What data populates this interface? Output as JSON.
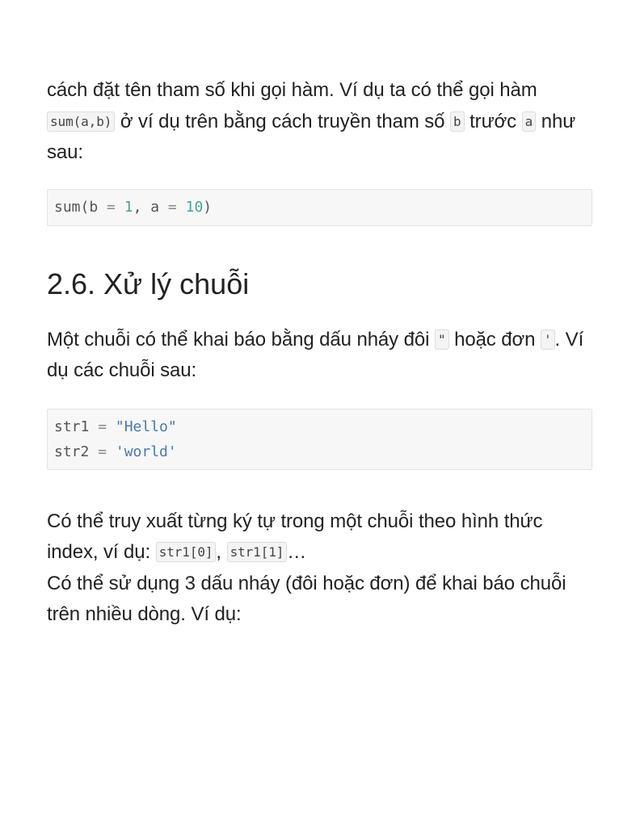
{
  "para1": {
    "text1": "cách đặt tên tham số khi gọi hàm. Ví dụ ta có thể gọi hàm ",
    "code1": "sum(a,b)",
    "text2": " ở ví dụ trên bằng cách truyền tham số ",
    "code2": "b",
    "text3": " trước ",
    "code3": "a",
    "text4": " như sau:"
  },
  "code_block1": {
    "t1": "sum(b ",
    "op1": "=",
    "t2": " ",
    "n1": "1",
    "t3": ", a ",
    "op2": "=",
    "t4": " ",
    "n2": "10",
    "t5": ")"
  },
  "heading": "2.6. Xử lý chuỗi",
  "para2": {
    "text1": "Một chuỗi có thể khai báo bằng dấu nháy đôi ",
    "code1": "\"",
    "text2": " hoặc đơn ",
    "code2": "'",
    "text3": ". Ví dụ các chuỗi sau:"
  },
  "code_block2": {
    "line1_var": "str1 ",
    "line1_op": "=",
    "line1_str": "\"Hello\"",
    "line2_var": "str2 ",
    "line2_op": "=",
    "line2_str": "'world'"
  },
  "para3": {
    "text1": "Có thể truy xuất từng ký tự trong một chuỗi theo hình thức index, ví dụ: ",
    "code1": "str1[0]",
    "text2": ", ",
    "code2": "str1[1]",
    "text3": "…",
    "text4": "Có thể sử dụng 3 dấu nháy (đôi hoặc đơn) để khai báo chuỗi trên nhiều dòng. Ví dụ:"
  }
}
